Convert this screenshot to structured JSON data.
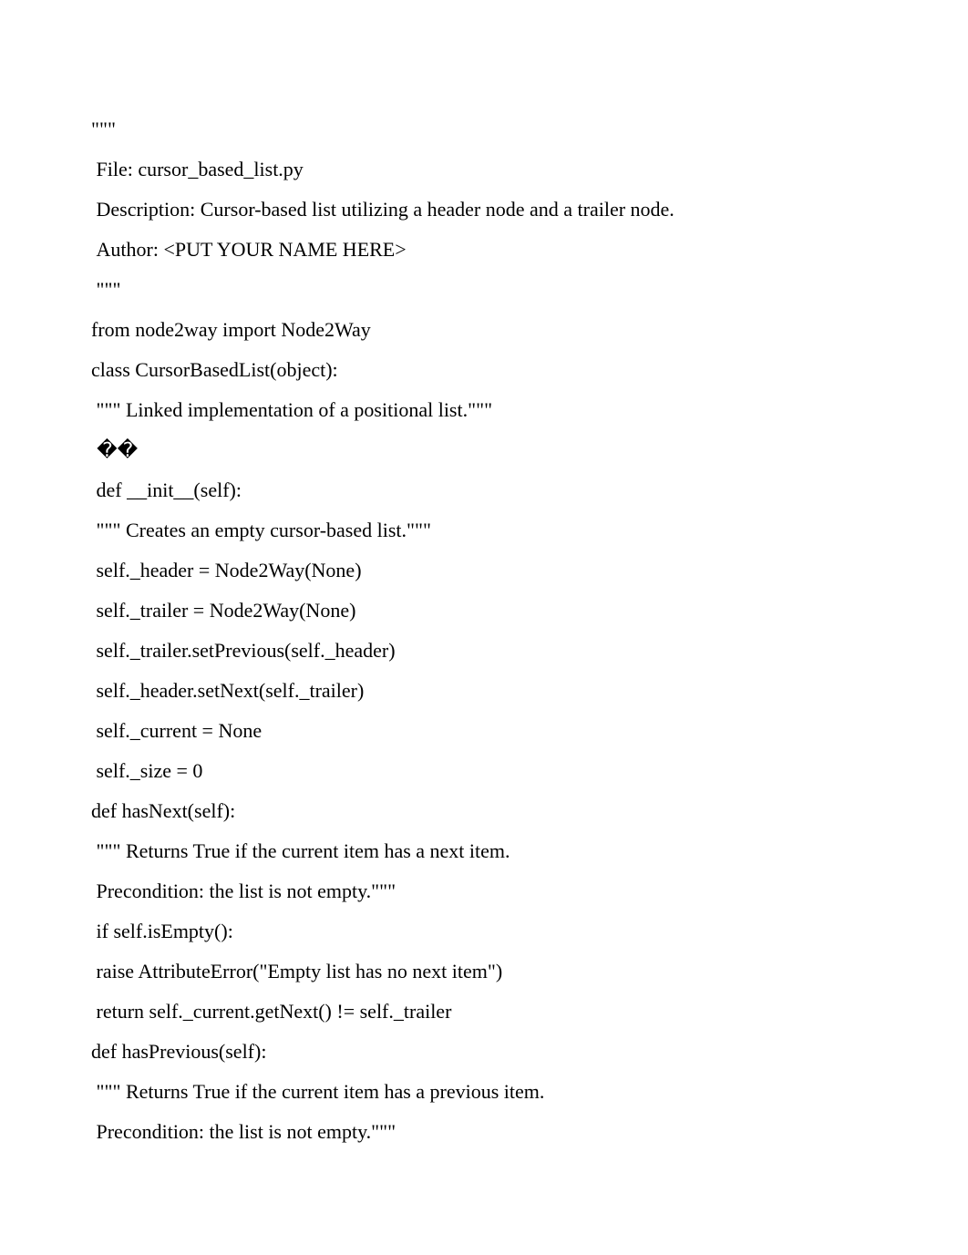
{
  "lines": [
    "\"\"\"",
    " File: cursor_based_list.py",
    " Description: Cursor-based list utilizing a header node and a trailer node.",
    " Author: <PUT YOUR NAME HERE>",
    " \"\"\"",
    "from node2way import Node2Way",
    "class CursorBasedList(object):",
    " \"\"\" Linked implementation of a positional list.\"\"\"",
    " ��",
    " def __init__(self):",
    " \"\"\" Creates an empty cursor-based list.\"\"\"",
    " self._header = Node2Way(None)",
    " self._trailer = Node2Way(None)",
    " self._trailer.setPrevious(self._header)",
    " self._header.setNext(self._trailer)",
    " self._current = None",
    " self._size = 0",
    "def hasNext(self):",
    " \"\"\" Returns True if the current item has a next item.",
    " Precondition: the list is not empty.\"\"\"",
    " if self.isEmpty():",
    " raise AttributeError(\"Empty list has no next item\")",
    " return self._current.getNext() != self._trailer",
    "def hasPrevious(self):",
    " \"\"\" Returns True if the current item has a previous item.",
    " Precondition: the list is not empty.\"\"\""
  ]
}
